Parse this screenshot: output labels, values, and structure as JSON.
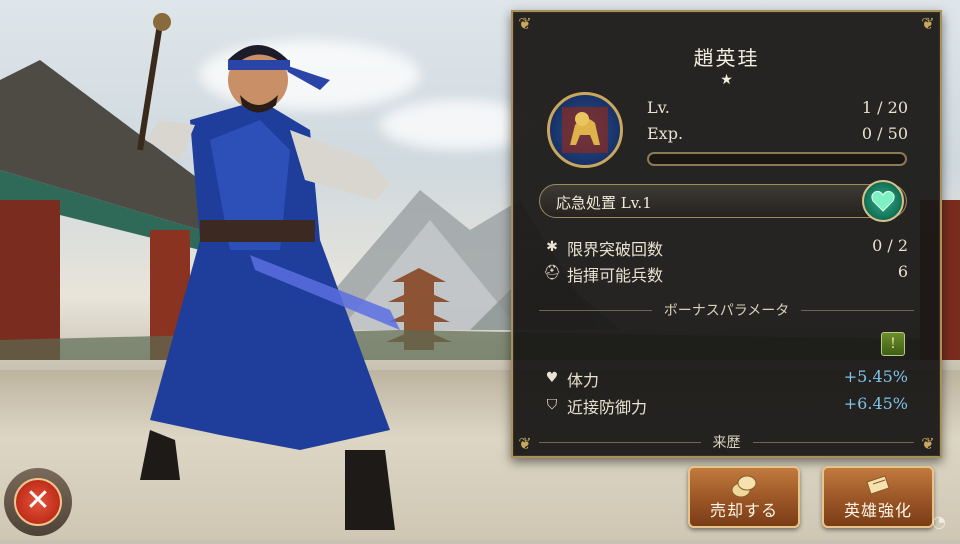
{
  "hero": {
    "name": "趙英珪",
    "stars": "★",
    "emblem": "golden-tiger-emblem"
  },
  "stats": {
    "lv_label": "Lv.",
    "lv_value": "1 / 20",
    "exp_label": "Exp.",
    "exp_value": "0 / 50",
    "exp_progress": 0
  },
  "skill": {
    "name": "応急処置 Lv.1",
    "icon": "heart-gem-icon"
  },
  "limits": {
    "breakthrough_label": "限界突破回数",
    "breakthrough_value": "0 / 2",
    "troops_label": "指揮可能兵数",
    "troops_value": "6"
  },
  "bonus": {
    "header": "ボーナスパラメータ",
    "params": [
      {
        "label": "体力",
        "value": "+5.45%",
        "icon": "heart-icon"
      },
      {
        "label": "近接防御力",
        "value": "+6.45%",
        "icon": "shield-icon"
      }
    ]
  },
  "history": {
    "header": "来歴"
  },
  "buttons": {
    "sell_label": "売却する",
    "enhance_label": "英雄強化",
    "close_icon": "close-icon"
  },
  "colors": {
    "panel_border": "#a8905a",
    "bonus_text": "#7fc2e8",
    "button_orange": "#9a5526",
    "close_red": "#c3301c"
  }
}
